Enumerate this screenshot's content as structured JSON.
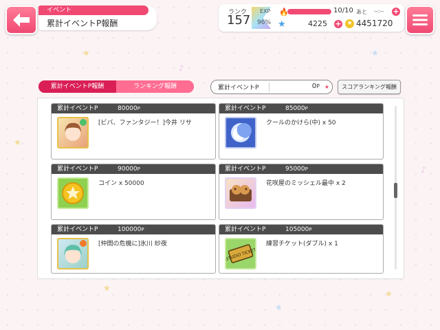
{
  "header": {
    "category": "イベント",
    "title": "累計イベントP報酬"
  },
  "status": {
    "rank_label": "ランク",
    "rank": "157",
    "exp_label": "EXP",
    "exp_percent": "96%",
    "stamina_value": "10/10",
    "stamina_fraction": 1.0,
    "stamina_note": "あと",
    "stamina_time": "--:--",
    "stars": "4225",
    "coins": "4451720"
  },
  "tabs": [
    {
      "label": "累計イベントP報酬",
      "active": true
    },
    {
      "label": "ランキング報酬",
      "active": false
    }
  ],
  "score": {
    "label": "累計イベントP",
    "value": "0",
    "unit": "P"
  },
  "score_ranking_button": "スコアランキング報酬",
  "rewards": [
    {
      "label": "累計イベントP",
      "points": "80000",
      "unit": "P",
      "item": "[ビバ、ファンタジー！]今井 リサ",
      "icon": "character-card-icon"
    },
    {
      "label": "累計イベントP",
      "points": "85000",
      "unit": "P",
      "item": "クールのかけら(中) x 50",
      "icon": "cool-shard-icon"
    },
    {
      "label": "累計イベントP",
      "points": "90000",
      "unit": "P",
      "item": "コイン x 50000",
      "icon": "coin-icon"
    },
    {
      "label": "累計イベントP",
      "points": "95000",
      "unit": "P",
      "item": "花咲屋のミッシェル最中 x 2",
      "icon": "michelle-monaka-icon"
    },
    {
      "label": "累計イベントP",
      "points": "100000",
      "unit": "P",
      "item": "[仲間の危機に]氷川 紗夜",
      "icon": "character-card-icon"
    },
    {
      "label": "累計イベントP",
      "points": "105000",
      "unit": "P",
      "item": "練習チケット(ダブル) x 1",
      "icon": "studio-ticket-icon"
    }
  ],
  "ticket_text": "STUDIO TICKET",
  "colors": {
    "accent": "#f04a73",
    "header_bar": "#4c4c4c"
  }
}
